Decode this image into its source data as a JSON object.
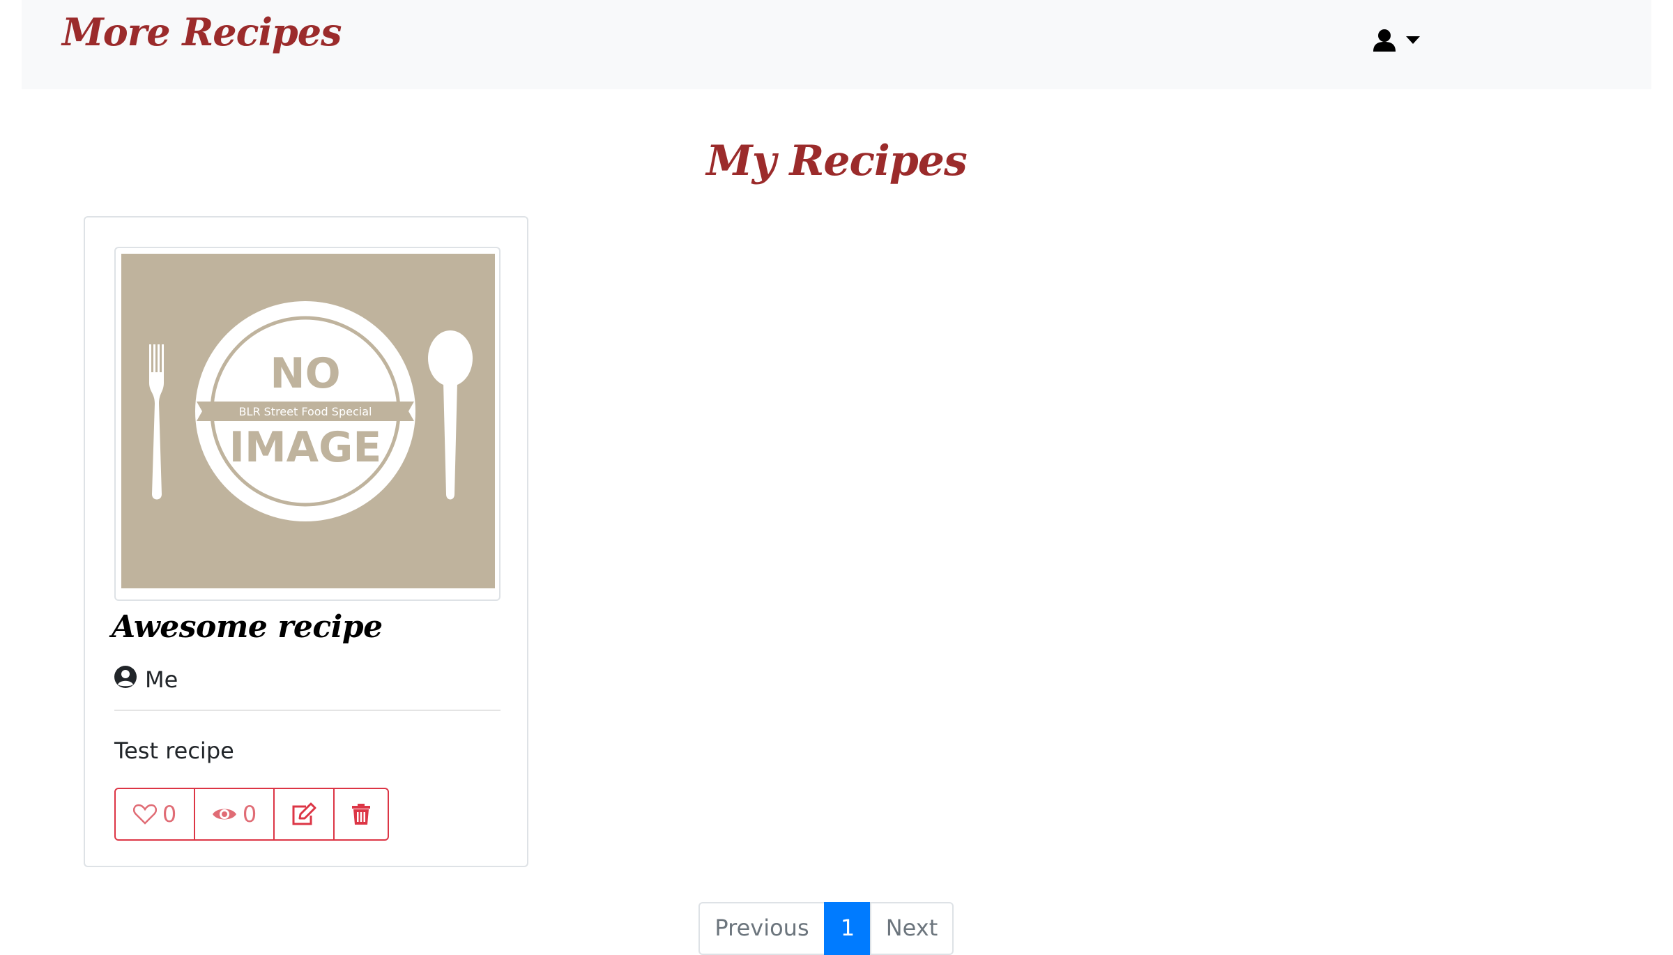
{
  "navbar": {
    "brand": "More Recipes",
    "user_icon": "user-icon",
    "dropdown_icon": "caret-down-icon"
  },
  "page": {
    "title": "My Recipes"
  },
  "recipes": [
    {
      "image": {
        "badge_top": "NO",
        "ribbon": "BLR Street Food Special",
        "badge_bottom": "IMAGE"
      },
      "title": "Awesome recipe",
      "author": "Me",
      "description": "Test recipe",
      "likes": "0",
      "views": "0",
      "actions": [
        "heart-icon",
        "eye-icon",
        "edit-icon",
        "trash-icon"
      ]
    }
  ],
  "pagination": {
    "previous": "Previous",
    "current": "1",
    "next": "Next"
  },
  "colors": {
    "brand": "#9b2b2b",
    "danger": "#dc3545",
    "primary": "#007bff",
    "navbar_bg": "#f8f9fa",
    "placeholder_bg": "#bfb39d"
  }
}
